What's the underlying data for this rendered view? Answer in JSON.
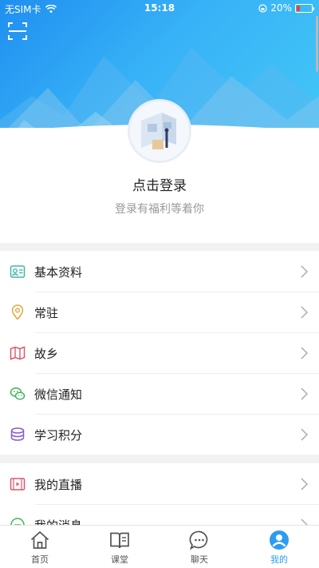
{
  "status_bar": {
    "carrier": "无SIM卡",
    "time": "15:18",
    "battery_percent": "20%",
    "battery_level": 0.2
  },
  "profile": {
    "login_title": "点击登录",
    "login_subtitle": "登录有福利等着你"
  },
  "menu_group_1": [
    {
      "label": "基本资料",
      "icon": "profile-card-icon"
    },
    {
      "label": "常驻",
      "icon": "location-pin-icon"
    },
    {
      "label": "故乡",
      "icon": "map-icon"
    },
    {
      "label": "微信通知",
      "icon": "wechat-icon"
    },
    {
      "label": "学习积分",
      "icon": "coins-stack-icon"
    }
  ],
  "menu_group_2": [
    {
      "label": "我的直播",
      "icon": "video-icon"
    },
    {
      "label": "我的消息",
      "icon": "message-icon"
    }
  ],
  "tabbar": [
    {
      "label": "首页",
      "icon": "home-icon",
      "active": false
    },
    {
      "label": "课堂",
      "icon": "book-icon",
      "active": false
    },
    {
      "label": "聊天",
      "icon": "chat-bubble-icon",
      "active": false
    },
    {
      "label": "我的",
      "icon": "user-icon",
      "active": true
    }
  ],
  "colors": {
    "accent": "#2d9cf0",
    "hero_start": "#1f8ff0",
    "hero_end": "#43c9f6"
  }
}
